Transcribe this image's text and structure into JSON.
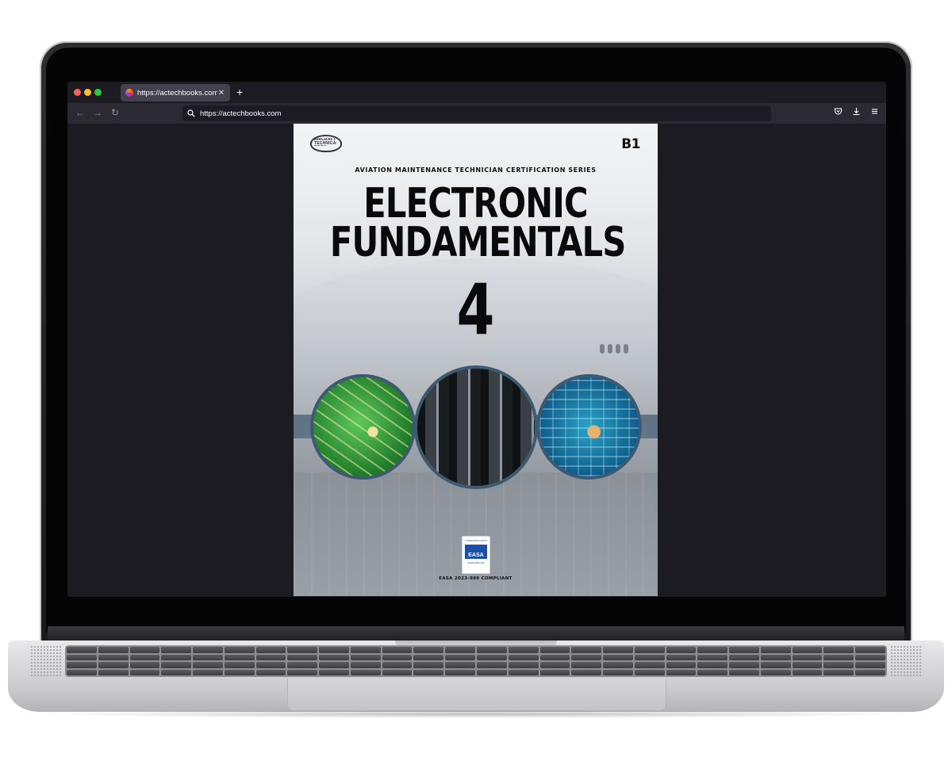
{
  "browser": {
    "tab": {
      "title": "https://actechbooks.com",
      "favicon": "firefox-icon"
    },
    "address_bar": {
      "url": "https://actechbooks.com"
    },
    "window_controls": {
      "close_color": "#ff5f57",
      "minimize_color": "#febc2e",
      "zoom_color": "#28c840"
    },
    "nav_icons": [
      "back-arrow-icon",
      "forward-arrow-icon",
      "reload-icon"
    ],
    "toolbar_icons": [
      "pocket-icon",
      "download-icon",
      "menu-icon"
    ]
  },
  "cover": {
    "publisher_logo": "AIRCRAFT TECHNICAL BOOK COMPANY",
    "category": "B1",
    "series": "AVIATION MAINTENANCE TECHNICIAN CERTIFICATION SERIES",
    "title_line1": "ELECTRONIC",
    "title_line2": "FUNDAMENTALS",
    "volume": "4",
    "badge": {
      "top": "COMPLIANT WITH",
      "name": "EASA",
      "sub": "EASA PART 66"
    },
    "compliance": "EASA 2023-989 COMPLIANT"
  }
}
